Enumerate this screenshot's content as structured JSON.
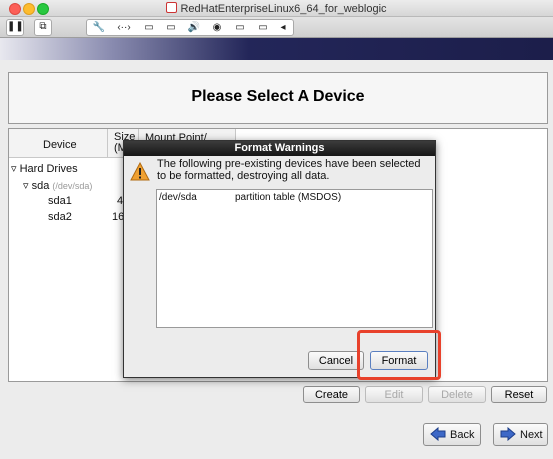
{
  "window": {
    "title": "RedHatEnterpriseLinux6_64_for_weblogic"
  },
  "toolbar": {
    "pause_glyph": "❚❚",
    "snapshot_glyph": "⧉",
    "tools": [
      "🔧",
      "‹··›",
      "▭",
      "▭",
      "🔊",
      "◉",
      "▭",
      "▭",
      "◂"
    ]
  },
  "installer": {
    "heading": "Please Select A Device",
    "columns": {
      "device": "Device",
      "size": "Size\n(M",
      "mount": "Mount Point/"
    },
    "tree": {
      "group": "Hard Drives",
      "disk": "sda",
      "disk_path": "(/dev/sda)",
      "partitions": [
        {
          "name": "sda1",
          "size": "4€"
        },
        {
          "name": "sda2",
          "size": "16:"
        }
      ]
    },
    "buttons": {
      "create": "Create",
      "edit": "Edit",
      "delete": "Delete",
      "reset": "Reset",
      "back": "Back",
      "next": "Next"
    }
  },
  "dialog": {
    "title": "Format Warnings",
    "message": "The following pre-existing devices have been selected to be formatted, destroying all data.",
    "rows": [
      {
        "device": "/dev/sda",
        "description": "partition table (MSDOS)"
      }
    ],
    "cancel_label": "Cancel",
    "format_label": "Format"
  },
  "colors": {
    "highlight": "#e8412b",
    "banner": "#1c1e4a"
  }
}
